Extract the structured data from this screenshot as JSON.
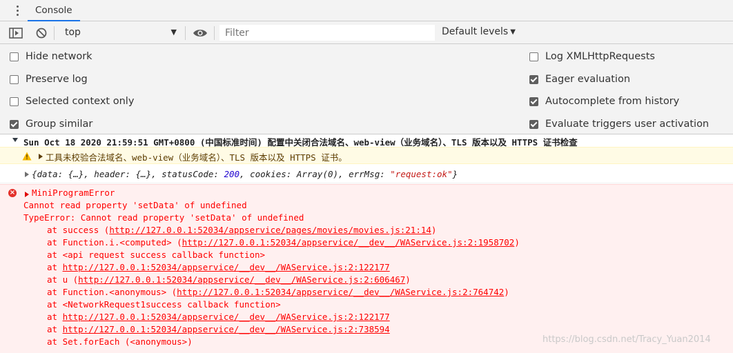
{
  "tabbar": {
    "tab_label": "Console"
  },
  "toolbar": {
    "context_value": "top",
    "filter_placeholder": "Filter",
    "levels_label": "Default levels"
  },
  "settings": {
    "left": [
      {
        "label": "Hide network",
        "checked": false
      },
      {
        "label": "Preserve log",
        "checked": false
      },
      {
        "label": "Selected context only",
        "checked": false
      },
      {
        "label": "Group similar",
        "checked": true
      }
    ],
    "right": [
      {
        "label": "Log XMLHttpRequests",
        "checked": false
      },
      {
        "label": "Eager evaluation",
        "checked": true
      },
      {
        "label": "Autocomplete from history",
        "checked": true
      },
      {
        "label": "Evaluate triggers user activation",
        "checked": true
      }
    ]
  },
  "console": {
    "group_title": "Sun Oct 18 2020 21:59:51 GMT+0800 (中国标准时间) 配置中关闭合法域名、web-view（业务域名）、TLS 版本以及 HTTPS 证书检查",
    "warning_text": "工具未校验合法域名、web-view（业务域名）、TLS 版本以及 HTTPS 证书。",
    "object": {
      "p1": "{data: {…}, header: {…}, statusCode: ",
      "status_code": "200",
      "p2": ", cookies: Array(0), errMsg: ",
      "err_msg": "\"request:ok\"",
      "p3": "}"
    },
    "error": {
      "title": "MiniProgramError",
      "lines": [
        {
          "text": "Cannot read property 'setData' of undefined",
          "indent": 0
        },
        {
          "text": "TypeError: Cannot read property 'setData' of undefined",
          "indent": 0
        },
        {
          "pre": "at success (",
          "link": "http://127.0.0.1:52034/appservice/pages/movies/movies.js:21:14",
          "post": ")",
          "indent": 1
        },
        {
          "pre": "at Function.i.<computed> (",
          "link": "http://127.0.0.1:52034/appservice/__dev__/WAService.js:2:1958702",
          "post": ")",
          "indent": 1
        },
        {
          "text": "at <api request success callback function>",
          "indent": 1
        },
        {
          "pre": "at ",
          "link": "http://127.0.0.1:52034/appservice/__dev__/WAService.js:2:122177",
          "post": "",
          "indent": 1
        },
        {
          "pre": "at u (",
          "link": "http://127.0.0.1:52034/appservice/__dev__/WAService.js:2:606467",
          "post": ")",
          "indent": 1
        },
        {
          "pre": "at Function.<anonymous> (",
          "link": "http://127.0.0.1:52034/appservice/__dev__/WAService.js:2:764742",
          "post": ")",
          "indent": 1
        },
        {
          "text": "at <NetworkRequest1success callback function>",
          "indent": 1
        },
        {
          "pre": "at ",
          "link": "http://127.0.0.1:52034/appservice/__dev__/WAService.js:2:122177",
          "post": "",
          "indent": 1
        },
        {
          "pre": "at ",
          "link": "http://127.0.0.1:52034/appservice/__dev__/WAService.js:2:738594",
          "post": "",
          "indent": 1
        },
        {
          "text": "at Set.forEach (<anonymous>)",
          "indent": 1
        }
      ]
    },
    "watermark": "https://blog.csdn.net/Tracy_Yuan2014"
  },
  "colors": {
    "error_text": "#ff0000",
    "error_bg": "#fff0f0",
    "warning_bg": "#fffbe5",
    "warning_text": "#5c3c00",
    "tab_underline": "#1a73e8"
  }
}
